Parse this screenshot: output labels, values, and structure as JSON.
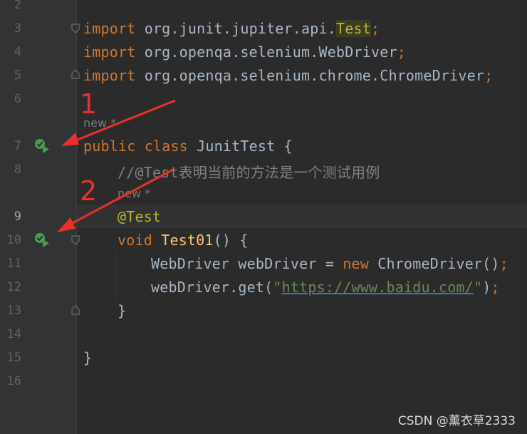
{
  "gutter": {
    "line_numbers": [
      "2",
      "3",
      "4",
      "5",
      "6",
      "7",
      "8",
      "9",
      "10",
      "11",
      "12",
      "13",
      "14",
      "15",
      "16"
    ]
  },
  "code": {
    "l3": {
      "kw": "import",
      "pkg": " org.junit.jupiter.api.",
      "cls": "Test",
      "semi": ";"
    },
    "l4": {
      "kw": "import",
      "pkg": " org.openqa.selenium.WebDriver",
      "semi": ";"
    },
    "l5": {
      "kw": "import",
      "pkg": " org.openqa.selenium.chrome.ChromeDriver",
      "semi": ";"
    },
    "hint_class": "new *",
    "l7": {
      "kw1": "public",
      "kw2": " class",
      "name": " JunitTest {"
    },
    "l8": {
      "comment": "//@Test表明当前的方法是一个测试用例"
    },
    "hint_method": "new *",
    "l9": {
      "ann": "@Test"
    },
    "l10": {
      "kw": "void",
      "fn": " Test01",
      "rest": "() {"
    },
    "l11": {
      "type": "WebDriver webDriver = ",
      "kw": "new",
      "rest": " ChromeDriver()",
      "semi": ";"
    },
    "l12": {
      "pre": "webDriver.get(",
      "q1": "\"",
      "url": "https://www.baidu.com/",
      "q2": "\"",
      "post": ")",
      "semi": ";"
    },
    "l13": {
      "brace": "}"
    },
    "l15": {
      "brace": "}"
    }
  },
  "annotations": {
    "one": "1",
    "two": "2"
  },
  "watermark": "CSDN @薰衣草2333",
  "colors": {
    "background": "#2b2b2b",
    "keyword": "#cc7832",
    "annotation": "#bbb529",
    "function": "#ffc66d",
    "string": "#6a8759",
    "arrow": "#e8312a",
    "run_icon": "#499c54"
  }
}
